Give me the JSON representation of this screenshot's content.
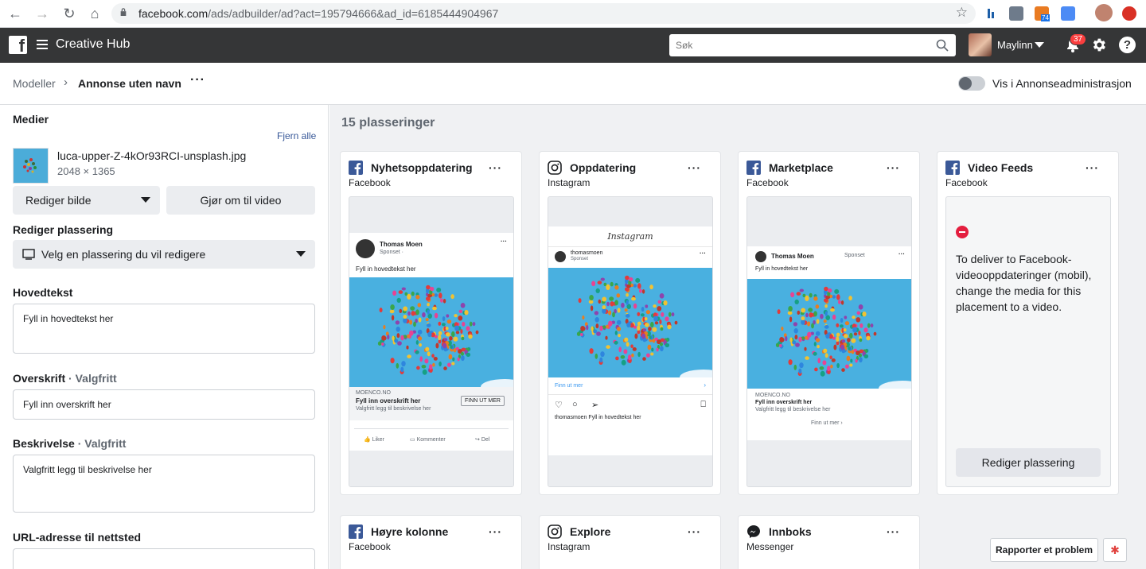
{
  "browser": {
    "url_host": "facebook.com",
    "url_rest": "/ads/adbuilder/ad?act=195794666&ad_id=6185444904967",
    "ext_badge": "74"
  },
  "header": {
    "app_title": "Creative Hub",
    "search_placeholder": "Søk",
    "user_name": "Maylinn",
    "notif_count": "37",
    "help": "?"
  },
  "breadcrumb": {
    "parent": "Modeller",
    "current": "Annonse uten navn",
    "more": "···",
    "toggle_label": "Vis i Annonseadministrasjon"
  },
  "left": {
    "media_label": "Medier",
    "remove_all": "Fjern alle",
    "file_name": "luca-upper-Z-4kOr93RCI-unsplash.jpg",
    "file_dims": "2048 × 1365",
    "edit_image": "Rediger bilde",
    "to_video": "Gjør om til video",
    "placement_label": "Rediger plassering",
    "placement_select": "Velg en plassering du vil redigere",
    "main_text_label": "Hovedtekst",
    "main_text_value": "Fyll in hovedtekst her",
    "headline_label": "Overskrift",
    "headline_opt": " · Valgfritt",
    "headline_value": "Fyll inn overskrift her",
    "desc_label": "Beskrivelse",
    "desc_opt": " · Valgfritt",
    "desc_value": "Valgfritt legg til beskrivelse her",
    "url_label": "URL-adresse til nettsted"
  },
  "right": {
    "count_label": "15 plasseringer",
    "cards": [
      {
        "title": "Nyhetsoppdatering",
        "sub": "Facebook",
        "icon": "facebook-icon"
      },
      {
        "title": "Oppdatering",
        "sub": "Instagram",
        "icon": "instagram-icon"
      },
      {
        "title": "Marketplace",
        "sub": "Facebook",
        "icon": "facebook-icon"
      },
      {
        "title": "Video Feeds",
        "sub": "Facebook",
        "icon": "facebook-icon"
      },
      {
        "title": "Høyre kolonne",
        "sub": "Facebook",
        "icon": "facebook-icon"
      },
      {
        "title": "Explore",
        "sub": "Instagram",
        "icon": "instagram-icon"
      },
      {
        "title": "Innboks",
        "sub": "Messenger",
        "icon": "messenger-icon"
      }
    ],
    "fb_preview": {
      "page_name": "Thomas Moen",
      "sponsored": "Sponset · ",
      "main_text": "Fyll in hovedtekst her",
      "domain": "MOENCO.NO",
      "headline": "Fyll inn overskrift her",
      "description": "Valgfritt legg til beskrivelse her",
      "cta": "FINN UT MER",
      "like": "Liker",
      "comment": "Kommenter",
      "share": "Del"
    },
    "ig_preview": {
      "logo": "Instagram",
      "handle": "thomasmoen",
      "sponsored": "Sponset",
      "cta": "Finn ut mer",
      "caption_user": "thomasmoen",
      "caption_text": " Fyll in hovedtekst her"
    },
    "mp_preview": {
      "page_name": "Thomas Moen",
      "sponsored": "Sponset",
      "main_text": "Fyll in hovedtekst her",
      "domain": "MOENCO.NO",
      "headline": "Fyll inn overskrift her",
      "description": "Valgfritt legg til beskrivelse her",
      "cta": "Finn ut mer ›"
    },
    "video_card": {
      "warning": "To deliver to Facebook-videooppdateringer (mobil), change the media for this placement to a video.",
      "button": "Rediger plassering"
    }
  },
  "footer": {
    "report": "Rapporter et problem"
  }
}
